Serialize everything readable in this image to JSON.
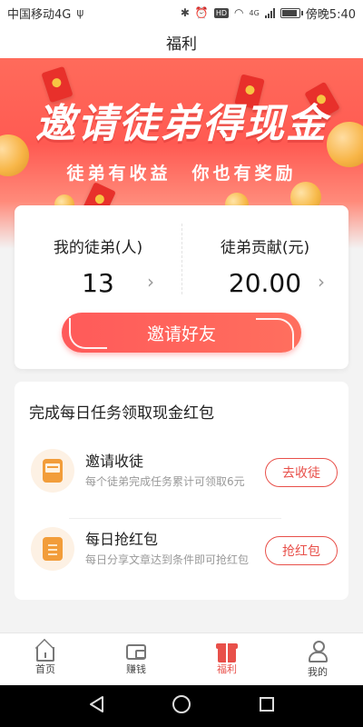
{
  "status_bar": {
    "carrier": "中国移动4G",
    "usb_icon": "usb-icon",
    "time": "傍晚5:40",
    "network": "4G",
    "icons": [
      "bluetooth-icon",
      "alarm-icon",
      "hd-icon",
      "wifi-icon",
      "signal-icon",
      "battery-icon"
    ]
  },
  "header": {
    "title": "福利"
  },
  "banner": {
    "title": "邀请徒弟得现金",
    "subtitle": "徒弟有收益　你也有奖励"
  },
  "stats": {
    "apprentices_label": "我的徒弟(人)",
    "apprentices_value": "13",
    "contribution_label": "徒弟贡献(元)",
    "contribution_value": "20.00",
    "invite_button": "邀请好友"
  },
  "tasks": {
    "title": "完成每日任务领取现金红包",
    "items": [
      {
        "icon": "envelope-icon",
        "name": "邀请收徒",
        "desc": "每个徒弟完成任务累计可领取6元",
        "button": "去收徒"
      },
      {
        "icon": "document-icon",
        "name": "每日抢红包",
        "desc": "每日分享文章达到条件即可抢红包",
        "button": "抢红包"
      }
    ]
  },
  "tabbar": {
    "items": [
      {
        "label": "首页",
        "icon": "home-icon",
        "active": false
      },
      {
        "label": "赚钱",
        "icon": "wallet-icon",
        "active": false
      },
      {
        "label": "福利",
        "icon": "gift-icon",
        "active": true
      },
      {
        "label": "我的",
        "icon": "user-icon",
        "active": false
      }
    ]
  },
  "colors": {
    "accent": "#e8504a",
    "banner_red": "#ff5a52",
    "task_icon_orange": "#f29d3a"
  }
}
